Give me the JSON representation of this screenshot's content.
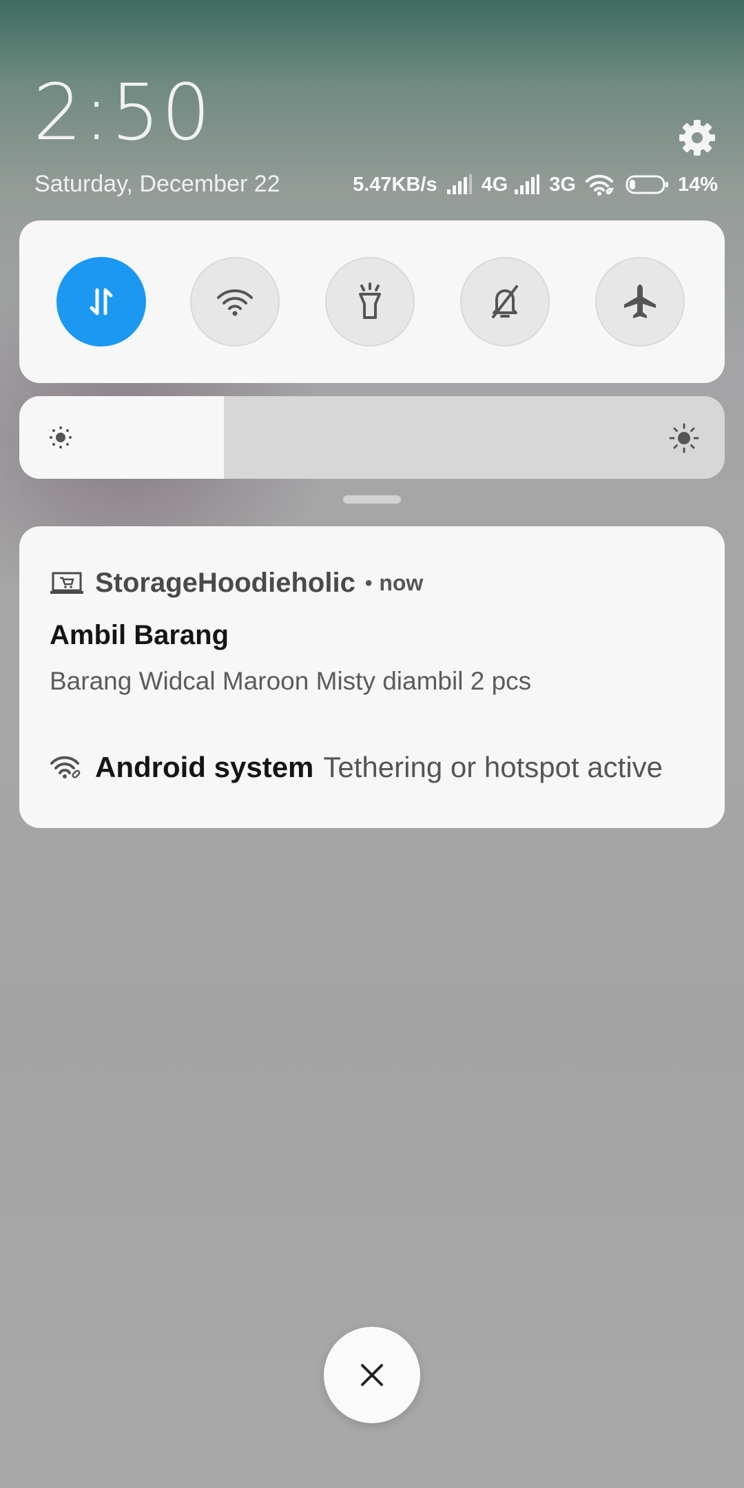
{
  "header": {
    "time": "2:50",
    "date": "Saturday, December 22"
  },
  "status": {
    "speed": "5.47KB/s",
    "net1": "4G",
    "net2": "3G",
    "battery": "14%",
    "battery_level": 0.14
  },
  "quick_toggles": [
    {
      "name": "mobile-data",
      "icon": "data-arrows-icon",
      "active": true
    },
    {
      "name": "wifi",
      "icon": "wifi-icon",
      "active": false
    },
    {
      "name": "flashlight",
      "icon": "flashlight-icon",
      "active": false
    },
    {
      "name": "silent",
      "icon": "bell-off-icon",
      "active": false
    },
    {
      "name": "airplane-mode",
      "icon": "airplane-icon",
      "active": false
    }
  ],
  "brightness": {
    "level": 0.29
  },
  "notification": {
    "app": "StorageHoodieholic",
    "time": "now",
    "title": "Ambil Barang",
    "body": "Barang Widcal Maroon Misty diambil 2 pcs"
  },
  "system_notification": {
    "app": "Android system",
    "text": "Tethering or hotspot active"
  },
  "colors": {
    "accent": "#1a98f2",
    "panel": "#f7f7f7"
  }
}
